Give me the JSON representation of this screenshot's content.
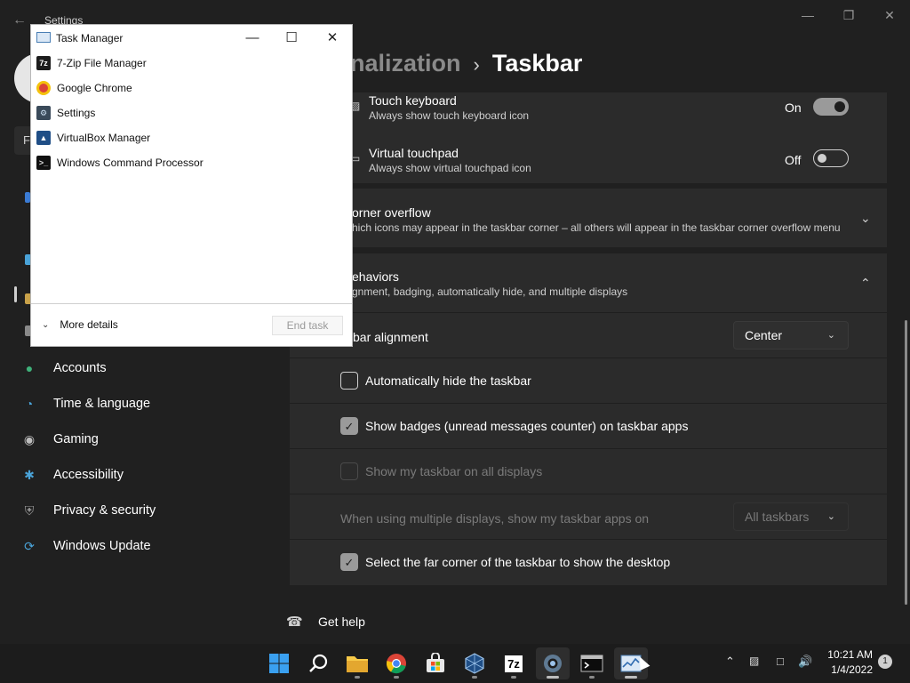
{
  "settings": {
    "window_title": "Settings",
    "breadcrumb": {
      "parent": "nalization",
      "current": "Taskbar"
    },
    "search_stub": "F",
    "nav": [
      {
        "label": "Accounts",
        "icon": "person-icon"
      },
      {
        "label": "Time & language",
        "icon": "globe-clock-icon"
      },
      {
        "label": "Gaming",
        "icon": "gamepad-icon"
      },
      {
        "label": "Accessibility",
        "icon": "accessibility-icon"
      },
      {
        "label": "Privacy & security",
        "icon": "shield-icon"
      },
      {
        "label": "Windows Update",
        "icon": "refresh-icon"
      }
    ],
    "touch_keyboard": {
      "title": "Touch keyboard",
      "subtitle": "Always show touch keyboard icon",
      "state": "On"
    },
    "virtual_touchpad": {
      "title": "Virtual touchpad",
      "subtitle": "Always show virtual touchpad icon",
      "state": "Off"
    },
    "corner_overflow": {
      "title": "orner overflow",
      "subtitle": "hich icons may appear in the taskbar corner – all others will appear in the taskbar corner overflow menu"
    },
    "behaviors": {
      "title": "ehaviors",
      "subtitle": "gnment, badging, automatically hide, and multiple displays",
      "alignment_label": "kbar alignment",
      "alignment_value": "Center",
      "auto_hide": "Automatically hide the taskbar",
      "show_badges": "Show badges (unread messages counter) on taskbar apps",
      "show_all_displays": "Show my taskbar on all displays",
      "multi_display_label": "When using multiple displays, show my taskbar apps on",
      "multi_display_value": "All taskbars",
      "far_corner": "Select the far corner of the taskbar to show the desktop"
    },
    "get_help": "Get help"
  },
  "task_manager": {
    "title": "Task Manager",
    "apps": [
      {
        "label": "7-Zip File Manager",
        "icon": "7zip-icon"
      },
      {
        "label": "Google Chrome",
        "icon": "chrome-icon"
      },
      {
        "label": "Settings",
        "icon": "settings-icon"
      },
      {
        "label": "VirtualBox Manager",
        "icon": "virtualbox-icon"
      },
      {
        "label": "Windows Command Processor",
        "icon": "cmd-icon"
      }
    ],
    "more_details": "More details",
    "end_task": "End task"
  },
  "taskbar": {
    "time": "10:21 AM",
    "date": "1/4/2022",
    "notification_count": "1",
    "apps": [
      "start",
      "search",
      "file-explorer",
      "chrome",
      "store",
      "virtualbox",
      "7zip",
      "settings",
      "cmd",
      "task-manager"
    ]
  },
  "colors": {
    "accent_gray": "#9a9a9a",
    "background": "#202020",
    "card": "#2b2b2b"
  }
}
